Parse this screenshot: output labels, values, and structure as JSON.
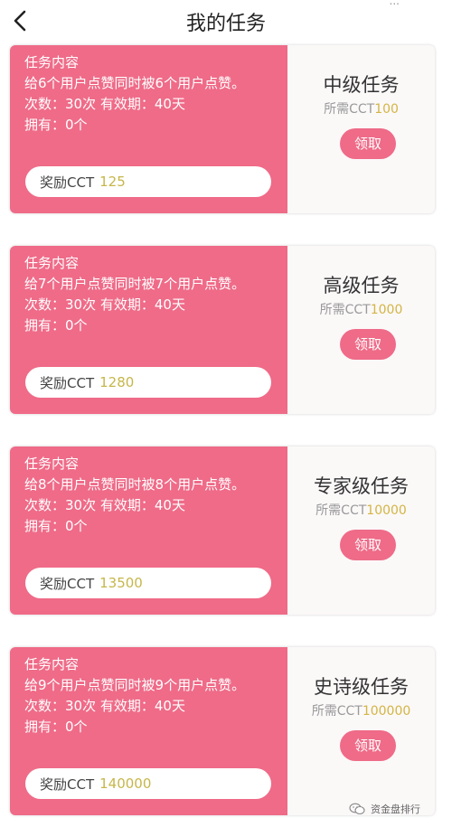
{
  "header": {
    "title": "我的任务",
    "dots": "..."
  },
  "tasks": [
    {
      "content_label": "任务内容",
      "description": "给6个用户点赞同时被6个用户点赞。",
      "count_validity": "次数：30次 有效期：40天",
      "owned": "拥有：0个",
      "reward_label": "奖励CCT",
      "reward_amount": "125",
      "level": "中级任务",
      "req_label": "所需CCT",
      "req_amount": "100",
      "claim": "领取"
    },
    {
      "content_label": "任务内容",
      "description": "给7个用户点赞同时被7个用户点赞。",
      "count_validity": "次数：30次 有效期：40天",
      "owned": "拥有：0个",
      "reward_label": "奖励CCT",
      "reward_amount": "1280",
      "level": "高级任务",
      "req_label": "所需CCT",
      "req_amount": "1000",
      "claim": "领取"
    },
    {
      "content_label": "任务内容",
      "description": "给8个用户点赞同时被8个用户点赞。",
      "count_validity": "次数：30次 有效期：40天",
      "owned": "拥有：0个",
      "reward_label": "奖励CCT",
      "reward_amount": "13500",
      "level": "专家级任务",
      "req_label": "所需CCT",
      "req_amount": "10000",
      "claim": "领取"
    },
    {
      "content_label": "任务内容",
      "description": "给9个用户点赞同时被9个用户点赞。",
      "count_validity": "次数：30次 有效期：40天",
      "owned": "拥有：0个",
      "reward_label": "奖励CCT",
      "reward_amount": "140000",
      "level": "史诗级任务",
      "req_label": "所需CCT",
      "req_amount": "100000",
      "claim": "领取"
    }
  ],
  "watermark": {
    "text": "资金盘排行"
  },
  "colors": {
    "card_pink": "#ef6b88",
    "reward_gold": "#c6b64a",
    "req_gold": "#d3b544"
  },
  "icons": {
    "back": "chevron-left-icon",
    "watermark": "wechat-icon"
  }
}
